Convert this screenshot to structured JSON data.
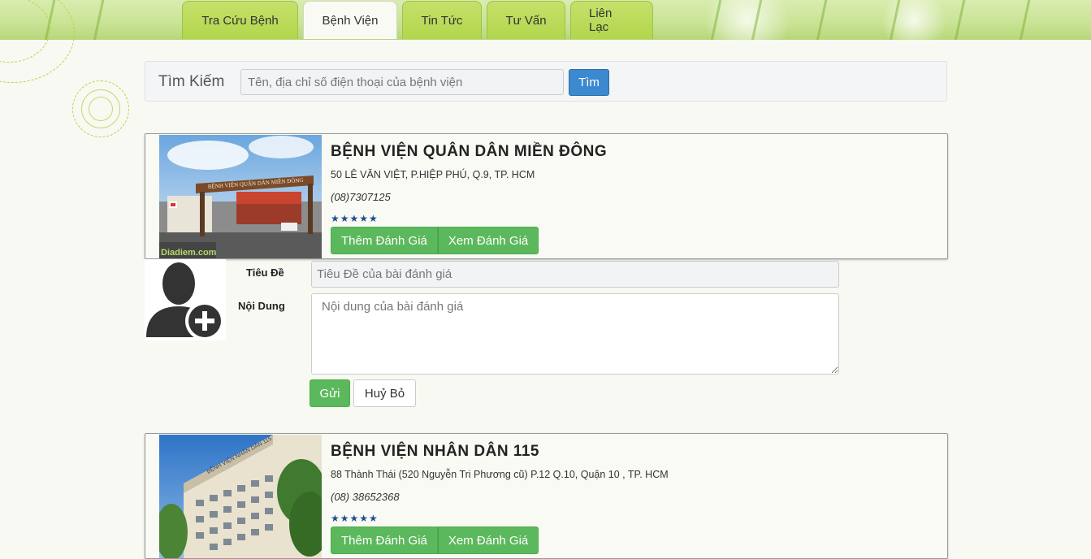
{
  "nav": {
    "tabs": [
      {
        "label": "Tra Cứu Bệnh",
        "active": false
      },
      {
        "label": "Bệnh Viện",
        "active": true
      },
      {
        "label": "Tin Tức",
        "active": false
      },
      {
        "label": "Tư Vấn",
        "active": false
      },
      {
        "label": "Liên Lạc",
        "active": false
      }
    ]
  },
  "search": {
    "label": "Tìm Kiếm",
    "placeholder": "Tên, địa chỉ số điện thoại của bệnh viện",
    "value": "",
    "button_label": "Tìm"
  },
  "hospitals": [
    {
      "name": "BỆNH VIỆN QUÂN DÂN MIỀN ĐÔNG",
      "address": "50 LÊ VĂN VIỆT, P.HIỆP PHÚ, Q.9, TP. HCM",
      "phone": "(08)7307125",
      "stars": "★★★★★",
      "rating": 5,
      "photo_sign": "BỆNH VIỆN QUÂN DÂN MIỀN ĐÔNG",
      "photo_watermark": "Diadiem.com",
      "add_review_label": "Thêm Đánh Giá",
      "view_review_label": "Xem Đánh Giá"
    },
    {
      "name": "BỆNH VIỆN NHÂN DÂN 115",
      "address": "88 Thành Thái (520 Nguyễn Tri Phương cũ) P.12 Q.10, Quận 10 , TP. HCM",
      "phone": "(08) 38652368",
      "stars": "★★★★★",
      "rating": 5,
      "photo_sign": "BỆNH VIỆN NHÂN DÂN 115",
      "add_review_label": "Thêm Đánh Giá",
      "view_review_label": "Xem Đánh Giá"
    }
  ],
  "review_form": {
    "title_label": "Tiêu Đề",
    "title_placeholder": "Tiêu Đề của bài đánh giá",
    "content_label": "Nội Dung",
    "content_placeholder": "Nội dung của bài đánh giá",
    "submit_label": "Gửi",
    "cancel_label": "Huỷ Bỏ"
  },
  "colors": {
    "primary_blue": "#3b8ad0",
    "success_green": "#5cb85c",
    "nav_green": "#b2d64c",
    "star_color": "#1f4e8c"
  },
  "icons": {
    "avatar": "add-user-icon",
    "star": "star-icon"
  }
}
